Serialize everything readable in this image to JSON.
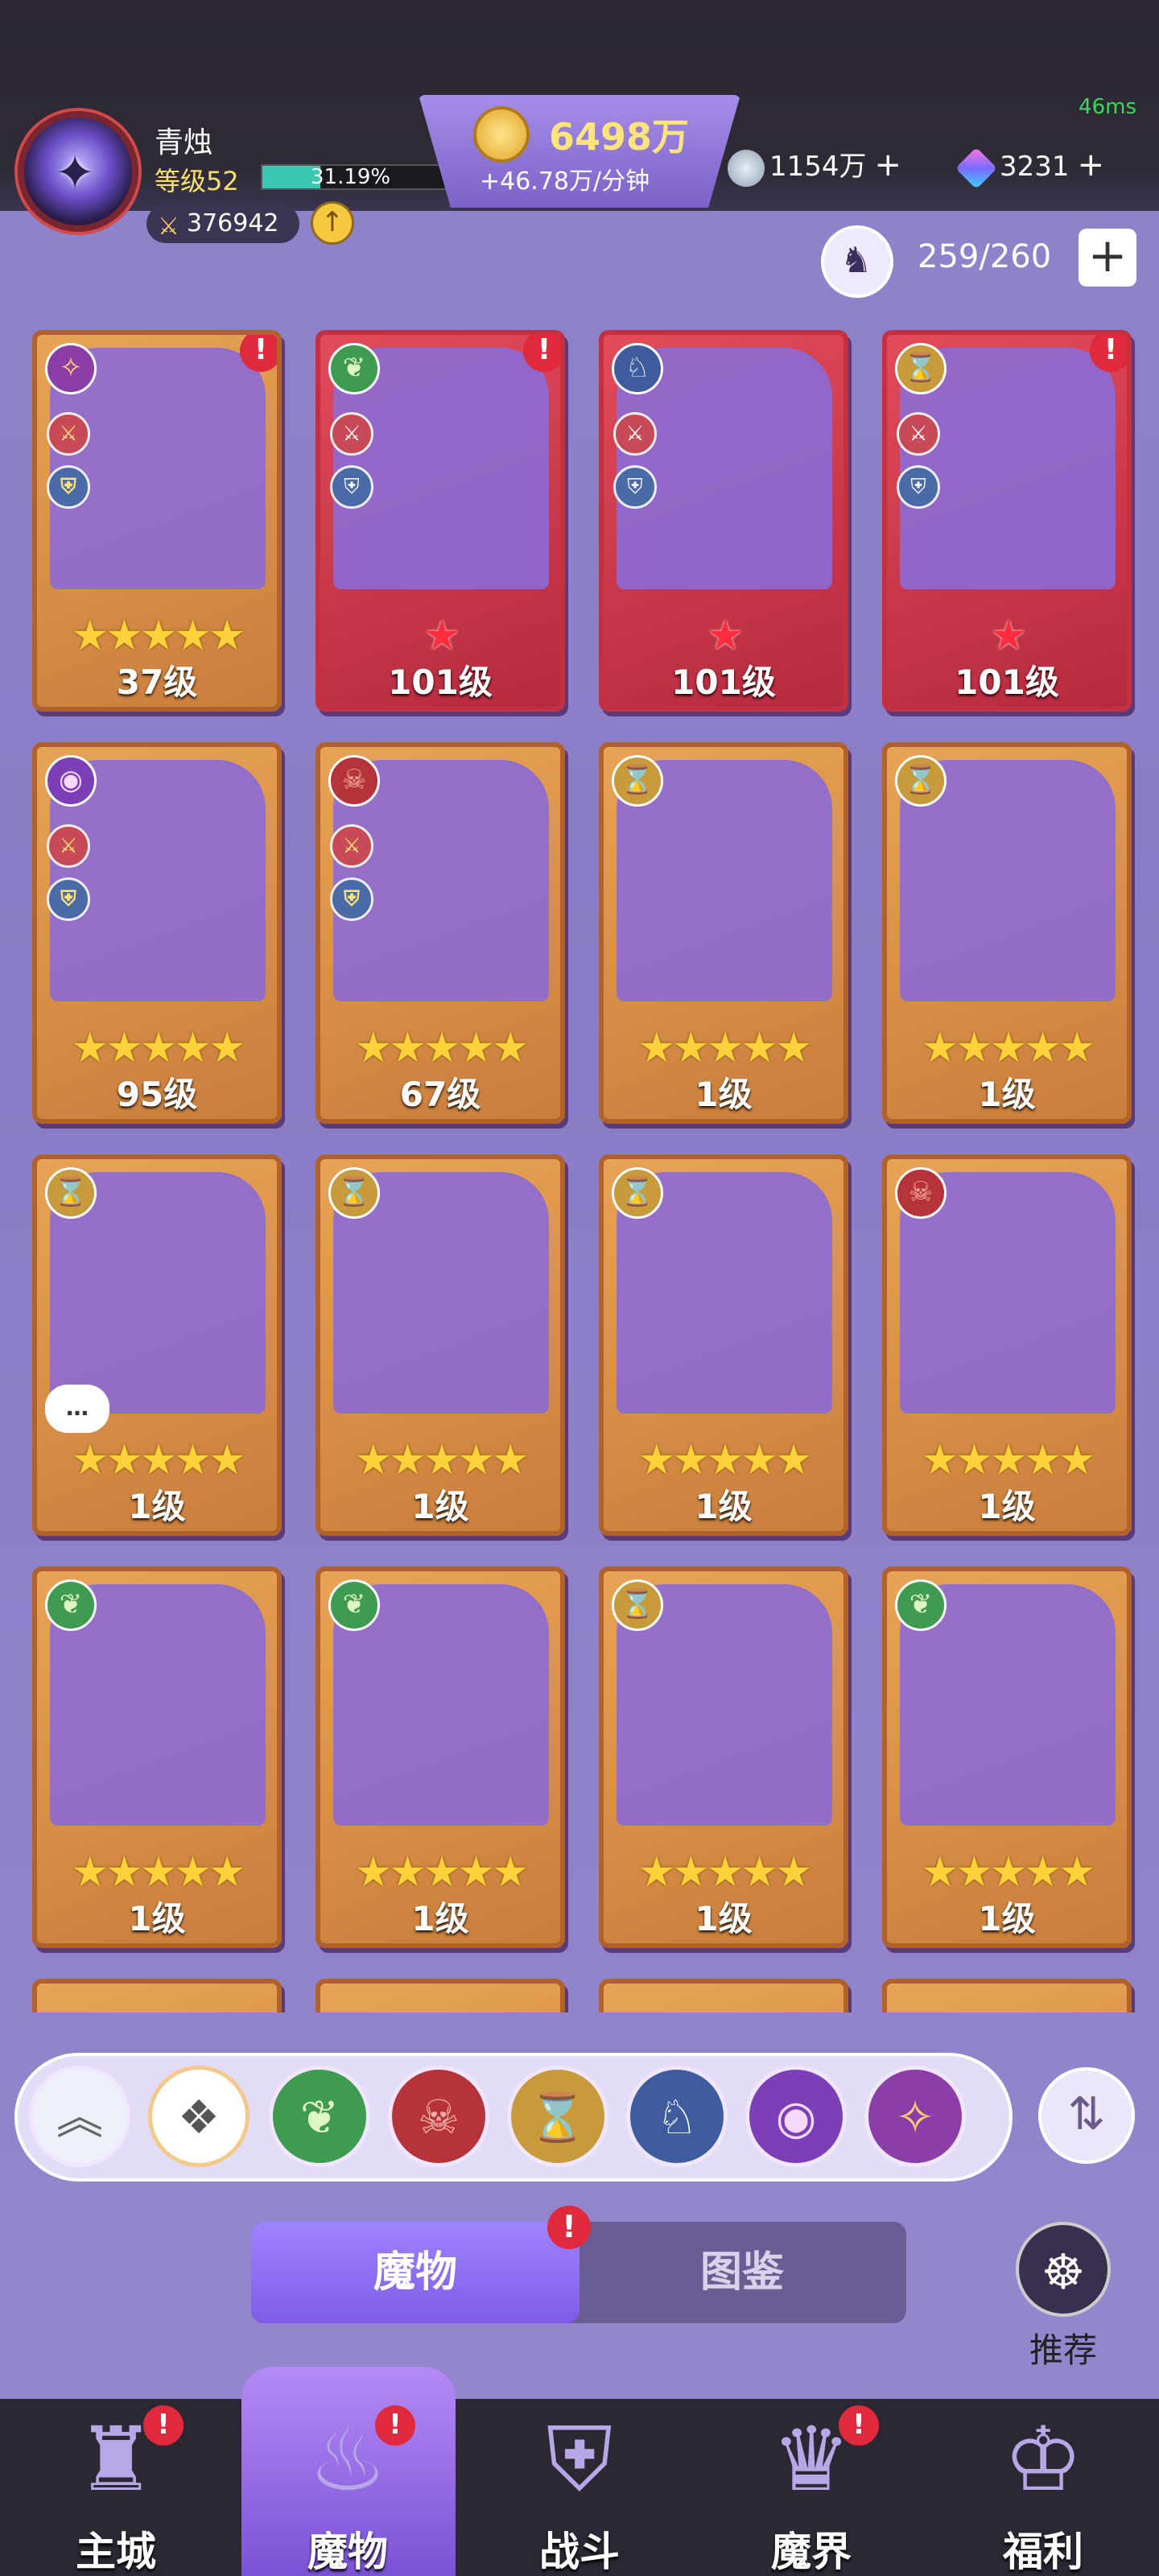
{
  "status": {
    "ping": "46ms"
  },
  "player": {
    "name": "青烛",
    "level": "等级52",
    "exp_text": "31.19%",
    "exp_percent": 31.19,
    "power": "376942"
  },
  "resources": {
    "gold": "6498万",
    "gold_rate": "+46.78万/分钟",
    "silver": "1154万",
    "gems": "3231"
  },
  "slots": {
    "text": "259/260"
  },
  "cards": [
    {
      "level": "37级",
      "stars": "★★★★★",
      "frame": "gold",
      "element": "twilight",
      "alert": "!"
    },
    {
      "level": "101级",
      "stars": "★",
      "frame": "red",
      "element": "nature",
      "alert": "!"
    },
    {
      "level": "101级",
      "stars": "★",
      "frame": "red",
      "element": "dragon",
      "alert": ""
    },
    {
      "level": "101级",
      "stars": "★",
      "frame": "red",
      "element": "hourglass",
      "alert": "!"
    },
    {
      "level": "95级",
      "stars": "★★★★★",
      "frame": "gold",
      "element": "eye",
      "alert": ""
    },
    {
      "level": "67级",
      "stars": "★★★★★",
      "frame": "gold",
      "element": "demon",
      "alert": ""
    },
    {
      "level": "1级",
      "stars": "★★★★★",
      "frame": "gold",
      "element": "hourglass",
      "alert": ""
    },
    {
      "level": "1级",
      "stars": "★★★★★",
      "frame": "gold",
      "element": "hourglass",
      "alert": ""
    },
    {
      "level": "1级",
      "stars": "★★★★★",
      "frame": "gold",
      "element": "hourglass",
      "alert": ""
    },
    {
      "level": "1级",
      "stars": "★★★★★",
      "frame": "gold",
      "element": "hourglass",
      "alert": ""
    },
    {
      "level": "1级",
      "stars": "★★★★★",
      "frame": "gold",
      "element": "hourglass",
      "alert": ""
    },
    {
      "level": "1级",
      "stars": "★★★★★",
      "frame": "gold",
      "element": "demon",
      "alert": ""
    },
    {
      "level": "1级",
      "stars": "★★★★★",
      "frame": "gold",
      "element": "nature",
      "alert": ""
    },
    {
      "level": "1级",
      "stars": "★★★★★",
      "frame": "gold",
      "element": "nature",
      "alert": ""
    },
    {
      "level": "1级",
      "stars": "★★★★★",
      "frame": "gold",
      "element": "hourglass",
      "alert": ""
    },
    {
      "level": "1级",
      "stars": "★★★★★",
      "frame": "gold",
      "element": "nature",
      "alert": ""
    }
  ],
  "filters": [
    "collapse",
    "all",
    "nature",
    "demon",
    "hourglass",
    "dragon",
    "eye",
    "twilight"
  ],
  "tabs": {
    "monsters": "魔物",
    "codex": "图鉴",
    "alert": "!"
  },
  "recommend": {
    "label": "推荐"
  },
  "nav": [
    {
      "label": "主城",
      "icon": "castle-icon",
      "alert": "!"
    },
    {
      "label": "魔物",
      "icon": "monster-flame-icon",
      "alert": "!"
    },
    {
      "label": "战斗",
      "icon": "battle-shield-icon",
      "alert": ""
    },
    {
      "label": "魔界",
      "icon": "demon-realm-icon",
      "alert": "!"
    },
    {
      "label": "福利",
      "icon": "gift-chest-icon",
      "alert": ""
    }
  ],
  "colors": {
    "accent": "#8e6ee8",
    "alert": "#e02a3b",
    "gold_star": "#ffd23a",
    "red_star": "#ff2d3d"
  }
}
